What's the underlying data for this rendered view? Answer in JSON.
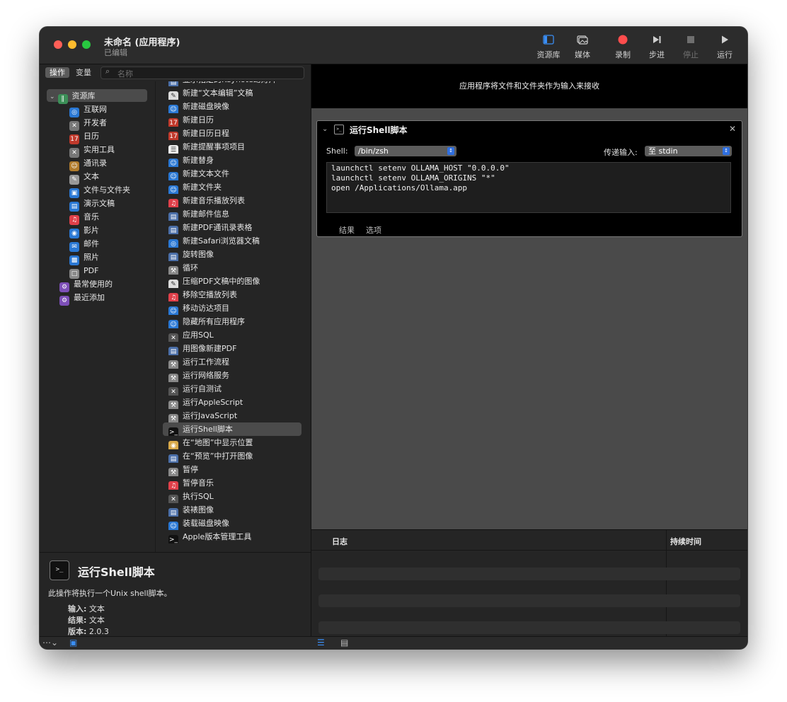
{
  "window": {
    "title": "未命名 (应用程序)",
    "subtitle": "已编辑"
  },
  "toolbar": {
    "library": "资源库",
    "media": "媒体",
    "record": "录制",
    "step": "步进",
    "stop": "停止",
    "run": "运行"
  },
  "left": {
    "seg_actions": "操作",
    "seg_variables": "变量",
    "search_placeholder": "名称"
  },
  "library": {
    "root": "资源库",
    "items": [
      "互联网",
      "开发者",
      "日历",
      "实用工具",
      "通讯录",
      "文本",
      "文件与文件夹",
      "演示文稿",
      "音乐",
      "影片",
      "邮件",
      "照片",
      "PDF"
    ],
    "smart": [
      "最常使用的",
      "最近添加"
    ]
  },
  "actions": [
    "显示指定的Keynote幻灯片",
    "新建“文本编辑”文稿",
    "新建磁盘映像",
    "新建日历",
    "新建日历日程",
    "新建提醒事项项目",
    "新建替身",
    "新建文本文件",
    "新建文件夹",
    "新建音乐播放列表",
    "新建邮件信息",
    "新建PDF通讯录表格",
    "新建Safari浏览器文稿",
    "旋转图像",
    "循环",
    "压缩PDF文稿中的图像",
    "移除空播放列表",
    "移动访达项目",
    "隐藏所有应用程序",
    "应用SQL",
    "用图像新建PDF",
    "运行工作流程",
    "运行网络服务",
    "运行自测试",
    "运行AppleScript",
    "运行JavaScript",
    "运行Shell脚本",
    "在“地图”中显示位置",
    "在“预览”中打开图像",
    "暂停",
    "暂停音乐",
    "执行SQL",
    "装裱图像",
    "装载磁盘映像",
    "Apple版本管理工具"
  ],
  "selected_action": "运行Shell脚本",
  "description": {
    "title": "运行Shell脚本",
    "text": "此操作将执行一个Unix shell脚本。",
    "input_label": "输入:",
    "input_value": "文本",
    "result_label": "结果:",
    "result_value": "文本",
    "version_label": "版本:",
    "version_value": "2.0.3"
  },
  "workflow": {
    "banner": "应用程序将文件和文件夹作为输入来接收",
    "card_title": "运行Shell脚本",
    "shell_label": "Shell:",
    "shell_value": "/bin/zsh",
    "pass_label": "传递输入:",
    "pass_value": "至 stdin",
    "code": "launchctl setenv OLLAMA_HOST \"0.0.0.0\"\nlaunchctl setenv OLLAMA_ORIGINS \"*\"\nopen /Applications/Ollama.app",
    "tab_results": "结果",
    "tab_options": "选项"
  },
  "log": {
    "col_log": "日志",
    "col_duration": "持续时间"
  },
  "colors": {
    "accent": "#3a8ef6",
    "record": "#ff4d4d"
  }
}
